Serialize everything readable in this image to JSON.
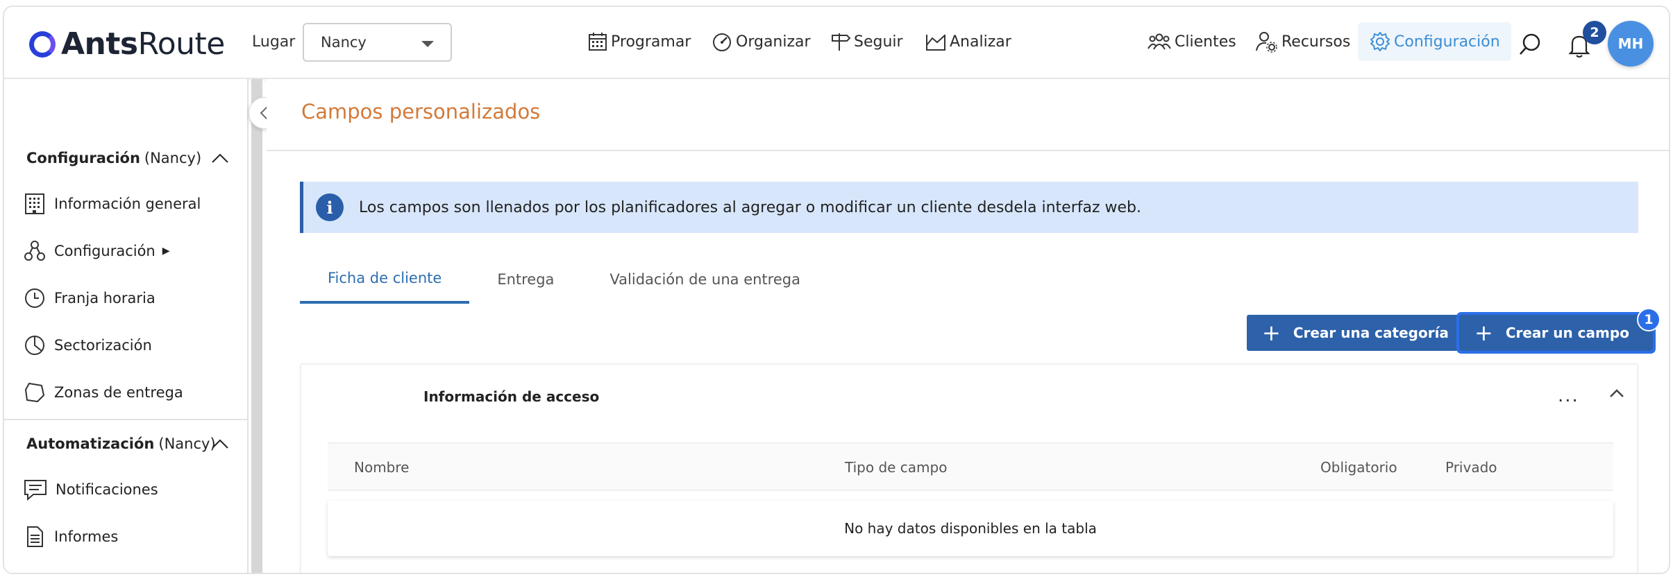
{
  "app": {
    "logo_bold": "Ants",
    "logo_light": "Route"
  },
  "header": {
    "lugar_label": "Lugar",
    "lugar_value": "Nancy",
    "nav": {
      "programar": "Programar",
      "organizar": "Organizar",
      "seguir": "Seguir",
      "analizar": "Analizar",
      "clientes": "Clientes",
      "recursos": "Recursos",
      "configuracion": "Configuración"
    },
    "notifications_count": "2",
    "avatar_initials": "MH"
  },
  "sidebar": {
    "section1_title": "Configuración",
    "section1_scope": "(Nancy)",
    "items1": [
      {
        "label": "Información general",
        "icon": "building-icon"
      },
      {
        "label": "Configuración",
        "icon": "cluster-icon"
      },
      {
        "label": "Franja horaria",
        "icon": "clock-icon"
      },
      {
        "label": "Sectorización",
        "icon": "pie-icon"
      },
      {
        "label": "Zonas de entrega",
        "icon": "polygon-icon"
      }
    ],
    "submenu_arrow": "▶",
    "section2_title": "Automatización",
    "section2_scope": "(Nancy)",
    "items2": [
      {
        "label": "Notificaciones",
        "icon": "message-icon"
      },
      {
        "label": "Informes",
        "icon": "document-icon"
      }
    ]
  },
  "main": {
    "page_title": "Campos personalizados",
    "info_text": "Los campos son llenados por los planificadores al agregar o modificar un cliente desdela interfaz web.",
    "tabs": [
      "Ficha de cliente",
      "Entrega",
      "Validación de una entrega"
    ],
    "active_tab": "Ficha de cliente",
    "btn_category": "Crear una categoría",
    "btn_field": "Crear un campo",
    "step_badge": "1",
    "panel_title": "Información de acceso",
    "more_label": "...",
    "columns": [
      "Nombre",
      "Tipo de campo",
      "Obligatorio",
      "Privado"
    ],
    "empty_text": "No hay datos disponibles en la tabla"
  },
  "colors": {
    "accent": "#2d61a9",
    "title_orange": "#d27a3a",
    "info_bg": "#d7e6fb",
    "active_nav": "#3b8dd6"
  }
}
